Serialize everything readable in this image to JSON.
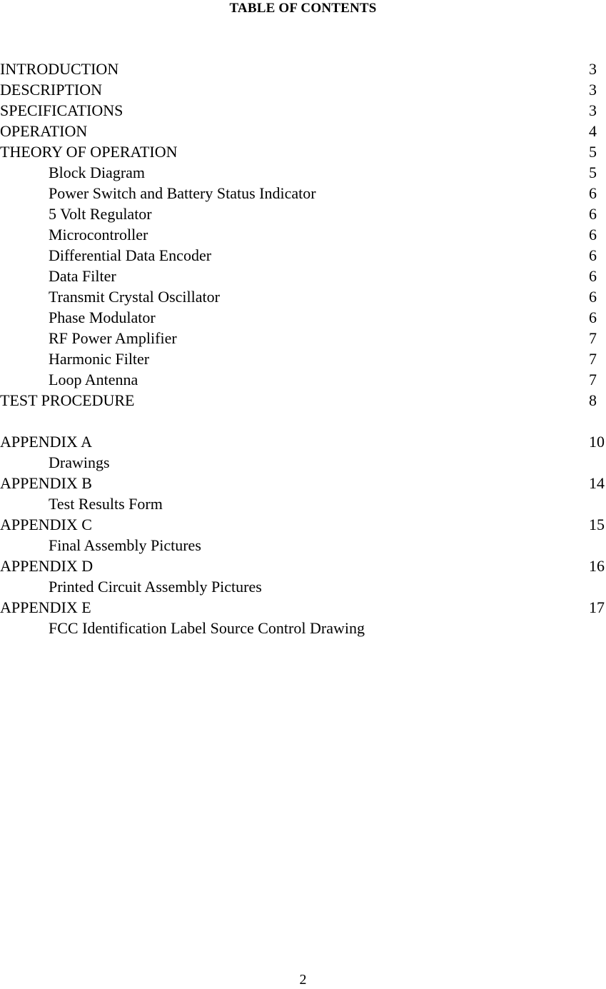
{
  "document": {
    "title": "TABLE OF CONTENTS",
    "page_number": "2"
  },
  "toc": {
    "entries": [
      {
        "label": "INTRODUCTION",
        "page": "3",
        "level": "main"
      },
      {
        "label": "DESCRIPTION",
        "page": "3",
        "level": "main"
      },
      {
        "label": "SPECIFICATIONS",
        "page": "3",
        "level": "main"
      },
      {
        "label": "OPERATION",
        "page": "4",
        "level": "main"
      },
      {
        "label": "THEORY OF OPERATION",
        "page": "5",
        "level": "main"
      },
      {
        "label": "Block Diagram",
        "page": "5",
        "level": "sub"
      },
      {
        "label": "Power Switch and Battery Status Indicator",
        "page": "6",
        "level": "sub"
      },
      {
        "label": "5 Volt Regulator",
        "page": "6",
        "level": "sub"
      },
      {
        "label": "Microcontroller",
        "page": "6",
        "level": "sub"
      },
      {
        "label": "Differential Data Encoder",
        "page": "6",
        "level": "sub"
      },
      {
        "label": "Data Filter",
        "page": "6",
        "level": "sub"
      },
      {
        "label": "Transmit Crystal Oscillator",
        "page": "6",
        "level": "sub"
      },
      {
        "label": "Phase Modulator",
        "page": "6",
        "level": "sub"
      },
      {
        "label": "RF Power Amplifier",
        "page": "7",
        "level": "sub"
      },
      {
        "label": "Harmonic Filter",
        "page": "7",
        "level": "sub"
      },
      {
        "label": "Loop Antenna",
        "page": "7",
        "level": "sub"
      },
      {
        "label": "TEST PROCEDURE",
        "page": "8",
        "level": "main"
      },
      {
        "label": "",
        "page": "",
        "level": "spacer"
      },
      {
        "label": "APPENDIX A",
        "page": "10",
        "level": "main"
      },
      {
        "label": "Drawings",
        "page": "",
        "level": "sub"
      },
      {
        "label": "APPENDIX B",
        "page": "14",
        "level": "main"
      },
      {
        "label": "Test Results Form",
        "page": "",
        "level": "sub"
      },
      {
        "label": "APPENDIX C",
        "page": "15",
        "level": "main"
      },
      {
        "label": "Final Assembly Pictures",
        "page": "",
        "level": "sub"
      },
      {
        "label": "APPENDIX D",
        "page": "16",
        "level": "main"
      },
      {
        "label": "Printed Circuit Assembly Pictures",
        "page": "",
        "level": "sub"
      },
      {
        "label": "APPENDIX E",
        "page": "17",
        "level": "main"
      },
      {
        "label": "FCC Identification Label Source Control Drawing",
        "page": "",
        "level": "sub"
      }
    ]
  }
}
